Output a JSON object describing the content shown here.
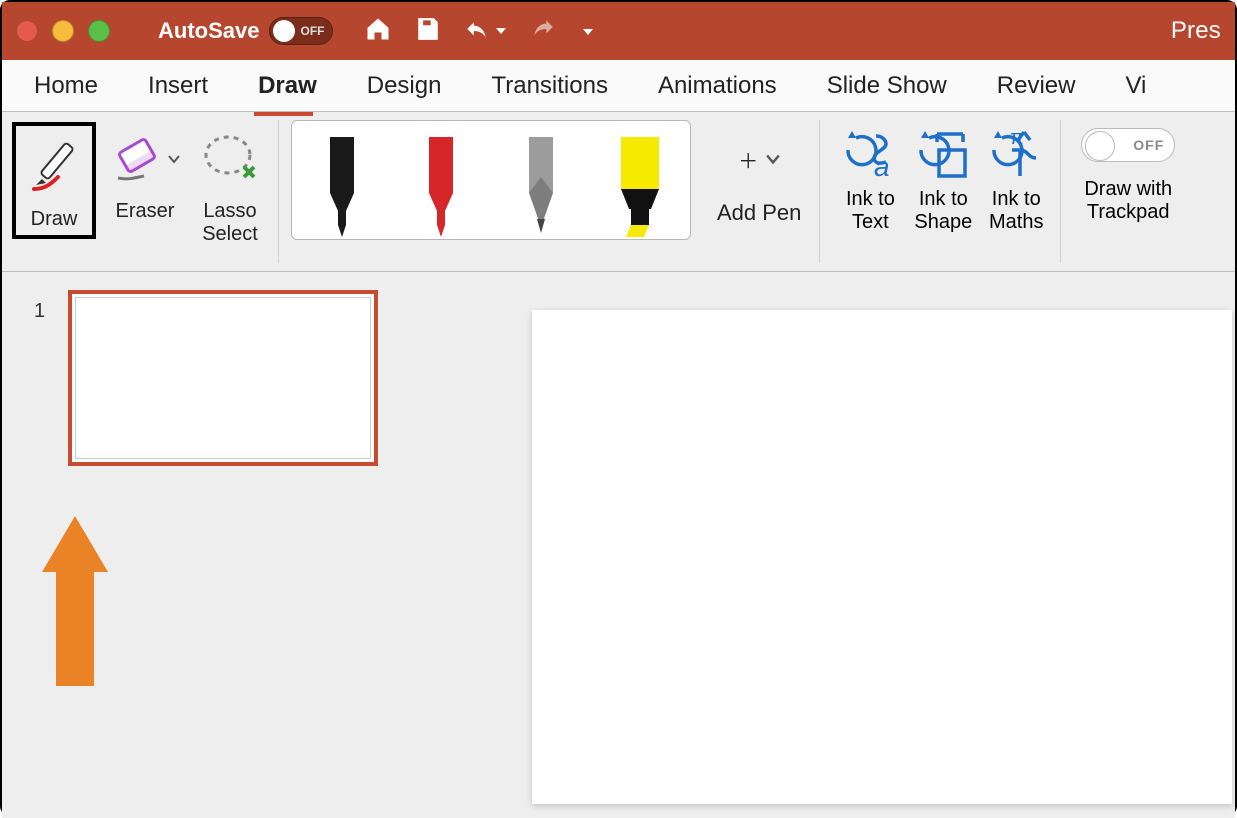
{
  "titlebar": {
    "autosave_label": "AutoSave",
    "autosave_state": "OFF",
    "document_title": "Pres"
  },
  "tabs": {
    "home": "Home",
    "insert": "Insert",
    "draw": "Draw",
    "design": "Design",
    "transitions": "Transitions",
    "animations": "Animations",
    "slideshow": "Slide Show",
    "review": "Review",
    "view_partial": "Vi"
  },
  "ribbon": {
    "draw_tool": "Draw",
    "eraser": "Eraser",
    "lasso": "Lasso\nSelect",
    "pens": {
      "pen1_color": "#1a1a1a",
      "pen2_color": "#d7262a",
      "pen3_color": "#7d7d7d",
      "highlighter_color": "#f6ea00"
    },
    "add_pen": "Add Pen",
    "ink_text": "Ink to\nText",
    "ink_shape": "Ink to\nShape",
    "ink_maths": "Ink to\nMaths",
    "trackpad_label": "Draw with\nTrackpad",
    "trackpad_state": "OFF"
  },
  "slides": {
    "current_index": "1"
  },
  "annotation": {
    "arrow_color": "#E98326"
  }
}
